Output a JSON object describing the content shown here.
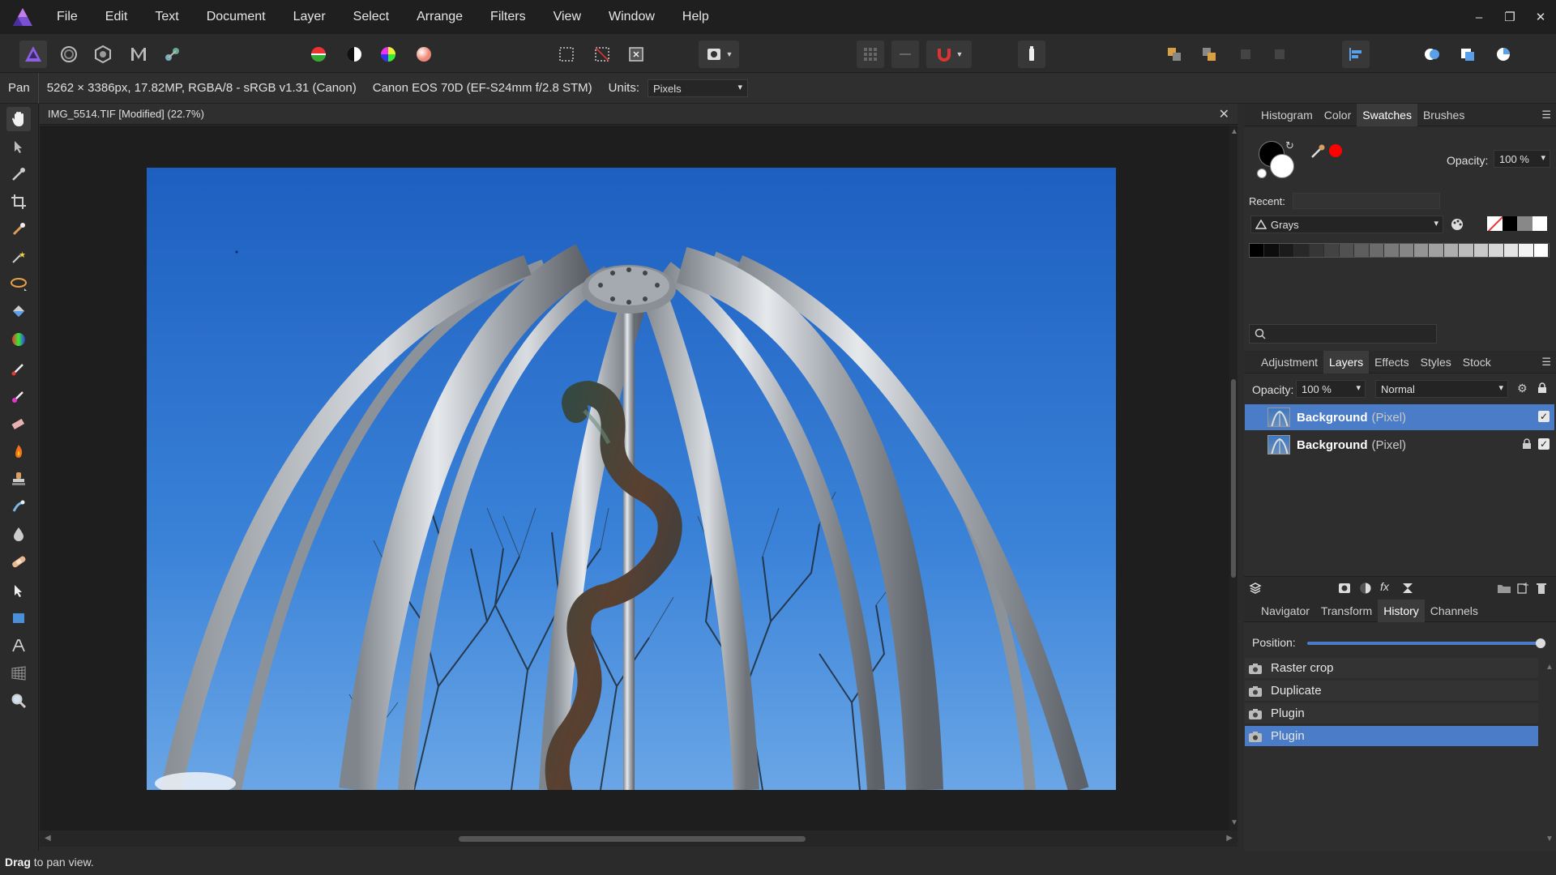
{
  "menubar": {
    "items": [
      "File",
      "Edit",
      "Text",
      "Document",
      "Layer",
      "Select",
      "Arrange",
      "Filters",
      "View",
      "Window",
      "Help"
    ],
    "window_controls": {
      "minimize": "–",
      "restore": "❐",
      "close": "✕"
    }
  },
  "context": {
    "tool": "Pan",
    "doc_info": "5262 × 3386px, 17.82MP, RGBA/8 - sRGB v1.31 (Canon)",
    "camera": "Canon EOS 70D (EF-S24mm f/2.8 STM)",
    "units_label": "Units:",
    "units_value": "Pixels"
  },
  "document": {
    "title": "IMG_5514.TIF [Modified] (22.7%)",
    "close": "✕"
  },
  "status": {
    "bold": "Drag",
    "text": " to pan view."
  },
  "swatches_panel": {
    "tabs": [
      "Histogram",
      "Color",
      "Swatches",
      "Brushes"
    ],
    "active_tab": "Swatches",
    "opacity_label": "Opacity:",
    "opacity_value": "100 %",
    "recent_label": "Recent:",
    "palette": "Grays",
    "colors": {
      "primary": "#000000",
      "secondary": "#ffffff",
      "accent": "#ff0000"
    }
  },
  "layers_panel": {
    "tabs": [
      "Adjustment",
      "Layers",
      "Effects",
      "Styles",
      "Stock"
    ],
    "active_tab": "Layers",
    "opacity_label": "Opacity:",
    "opacity_value": "100 %",
    "blend_mode": "Normal",
    "layers": [
      {
        "name": "Background",
        "kind": "(Pixel)"
      },
      {
        "name": "Background",
        "kind": "(Pixel)"
      }
    ]
  },
  "history_panel": {
    "tabs": [
      "Navigator",
      "Transform",
      "History",
      "Channels"
    ],
    "active_tab": "History",
    "position_label": "Position:",
    "position": 1.0,
    "items": [
      "Raster crop",
      "Duplicate",
      "Plugin",
      "Plugin"
    ]
  }
}
